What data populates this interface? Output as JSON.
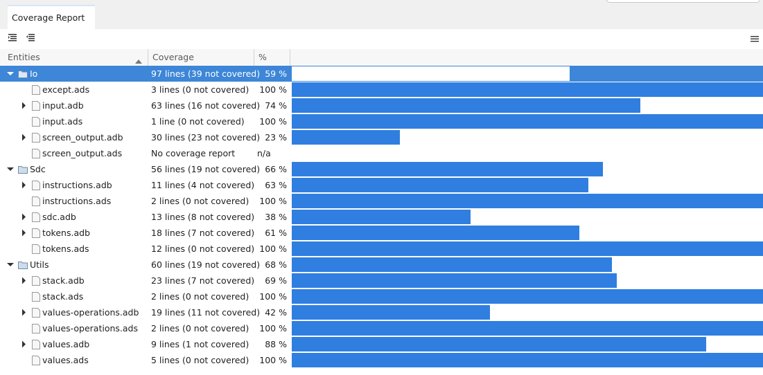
{
  "tab": {
    "title": "Coverage Report"
  },
  "header": {
    "entities": "Entities",
    "coverage": "Coverage",
    "percent": "%"
  },
  "icons": {
    "expand_all": "expand-all-icon",
    "collapse_all": "collapse-all-icon",
    "menu": "hamburger-menu-icon",
    "sort": "sort-ascending-icon"
  },
  "colors": {
    "bar": "#2f7ee0",
    "selection": "#3d86d8"
  },
  "rows": [
    {
      "name": "Io",
      "kind": "folder",
      "level": 0,
      "expander": "expanded",
      "coverage": "97 lines (39 not covered)",
      "percent": "59 %",
      "value": 59,
      "selected": true
    },
    {
      "name": "except.ads",
      "kind": "file",
      "level": 1,
      "expander": "none",
      "coverage": "3 lines (0 not covered)",
      "percent": "100 %",
      "value": 100
    },
    {
      "name": "input.adb",
      "kind": "file",
      "level": 1,
      "expander": "collapsed",
      "coverage": "63 lines (16 not covered)",
      "percent": "74 %",
      "value": 74
    },
    {
      "name": "input.ads",
      "kind": "file",
      "level": 1,
      "expander": "none",
      "coverage": "1 line (0 not covered)",
      "percent": "100 %",
      "value": 100
    },
    {
      "name": "screen_output.adb",
      "kind": "file",
      "level": 1,
      "expander": "collapsed",
      "coverage": "30 lines (23 not covered)",
      "percent": "23 %",
      "value": 23
    },
    {
      "name": "screen_output.ads",
      "kind": "file",
      "level": 1,
      "expander": "none",
      "coverage": "No coverage report",
      "percent": "n/a",
      "value": null
    },
    {
      "name": "Sdc",
      "kind": "folder",
      "level": 0,
      "expander": "expanded",
      "coverage": "56 lines (19 not covered)",
      "percent": "66 %",
      "value": 66
    },
    {
      "name": "instructions.adb",
      "kind": "file",
      "level": 1,
      "expander": "collapsed",
      "coverage": "11 lines (4 not covered)",
      "percent": "63 %",
      "value": 63
    },
    {
      "name": "instructions.ads",
      "kind": "file",
      "level": 1,
      "expander": "none",
      "coverage": "2 lines (0 not covered)",
      "percent": "100 %",
      "value": 100
    },
    {
      "name": "sdc.adb",
      "kind": "file",
      "level": 1,
      "expander": "collapsed",
      "coverage": "13 lines (8 not covered)",
      "percent": "38 %",
      "value": 38
    },
    {
      "name": "tokens.adb",
      "kind": "file",
      "level": 1,
      "expander": "collapsed",
      "coverage": "18 lines (7 not covered)",
      "percent": "61 %",
      "value": 61
    },
    {
      "name": "tokens.ads",
      "kind": "file",
      "level": 1,
      "expander": "none",
      "coverage": "12 lines (0 not covered)",
      "percent": "100 %",
      "value": 100
    },
    {
      "name": "Utils",
      "kind": "folder",
      "level": 0,
      "expander": "expanded",
      "coverage": "60 lines (19 not covered)",
      "percent": "68 %",
      "value": 68
    },
    {
      "name": "stack.adb",
      "kind": "file",
      "level": 1,
      "expander": "collapsed",
      "coverage": "23 lines (7 not covered)",
      "percent": "69 %",
      "value": 69
    },
    {
      "name": "stack.ads",
      "kind": "file",
      "level": 1,
      "expander": "none",
      "coverage": "2 lines (0 not covered)",
      "percent": "100 %",
      "value": 100
    },
    {
      "name": "values-operations.adb",
      "kind": "file",
      "level": 1,
      "expander": "collapsed",
      "coverage": "19 lines (11 not covered)",
      "percent": "42 %",
      "value": 42
    },
    {
      "name": "values-operations.ads",
      "kind": "file",
      "level": 1,
      "expander": "none",
      "coverage": "2 lines (0 not covered)",
      "percent": "100 %",
      "value": 100
    },
    {
      "name": "values.adb",
      "kind": "file",
      "level": 1,
      "expander": "collapsed",
      "coverage": "9 lines (1 not covered)",
      "percent": "88 %",
      "value": 88
    },
    {
      "name": "values.ads",
      "kind": "file",
      "level": 1,
      "expander": "none",
      "coverage": "5 lines (0 not covered)",
      "percent": "100 %",
      "value": 100
    }
  ]
}
